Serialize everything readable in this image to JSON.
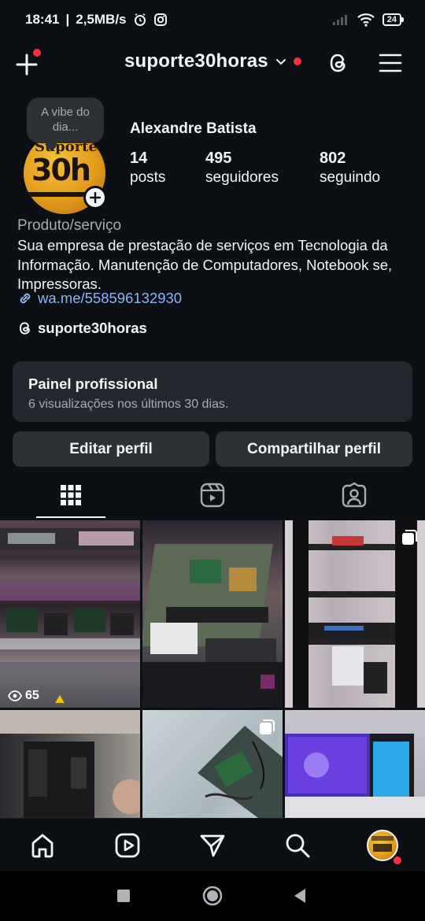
{
  "status_bar": {
    "time": "18:41",
    "network_speed": "2,5MB/s",
    "battery": "24"
  },
  "header": {
    "username": "suporte30horas"
  },
  "profile": {
    "note": "A vibe do dia...",
    "full_name": "Alexandre Batista",
    "stats": [
      {
        "value": "14",
        "label": "posts"
      },
      {
        "value": "495",
        "label": "seguidores"
      },
      {
        "value": "802",
        "label": "seguindo"
      }
    ],
    "category": "Produto/serviço",
    "bio": "Sua empresa de prestação de serviços em Tecnologia da Informação. Manutenção de Computadores, Notebook se, Impressoras.",
    "link": "wa.me/558596132930",
    "threads_handle": "suporte30horas",
    "avatar_text_top": "Suporte",
    "avatar_text_main": "30h"
  },
  "panel": {
    "title": "Painel profissional",
    "subtitle": "6 visualizações nos últimos 30 dias."
  },
  "buttons": {
    "edit": "Editar perfil",
    "share": "Compartilhar perfil"
  },
  "tabs": [
    "grid-icon",
    "reels-icon",
    "tagged-icon"
  ],
  "grid": {
    "posts": [
      {
        "type": "reel",
        "views": "65"
      },
      {
        "type": "photo"
      },
      {
        "type": "carousel"
      },
      {
        "type": "photo"
      },
      {
        "type": "carousel"
      },
      {
        "type": "photo"
      }
    ]
  },
  "colors": {
    "background": "#0c0f14",
    "card": "#24272d",
    "button": "#2d3136",
    "link": "#8fb3f9",
    "notification": "#ff3040"
  }
}
